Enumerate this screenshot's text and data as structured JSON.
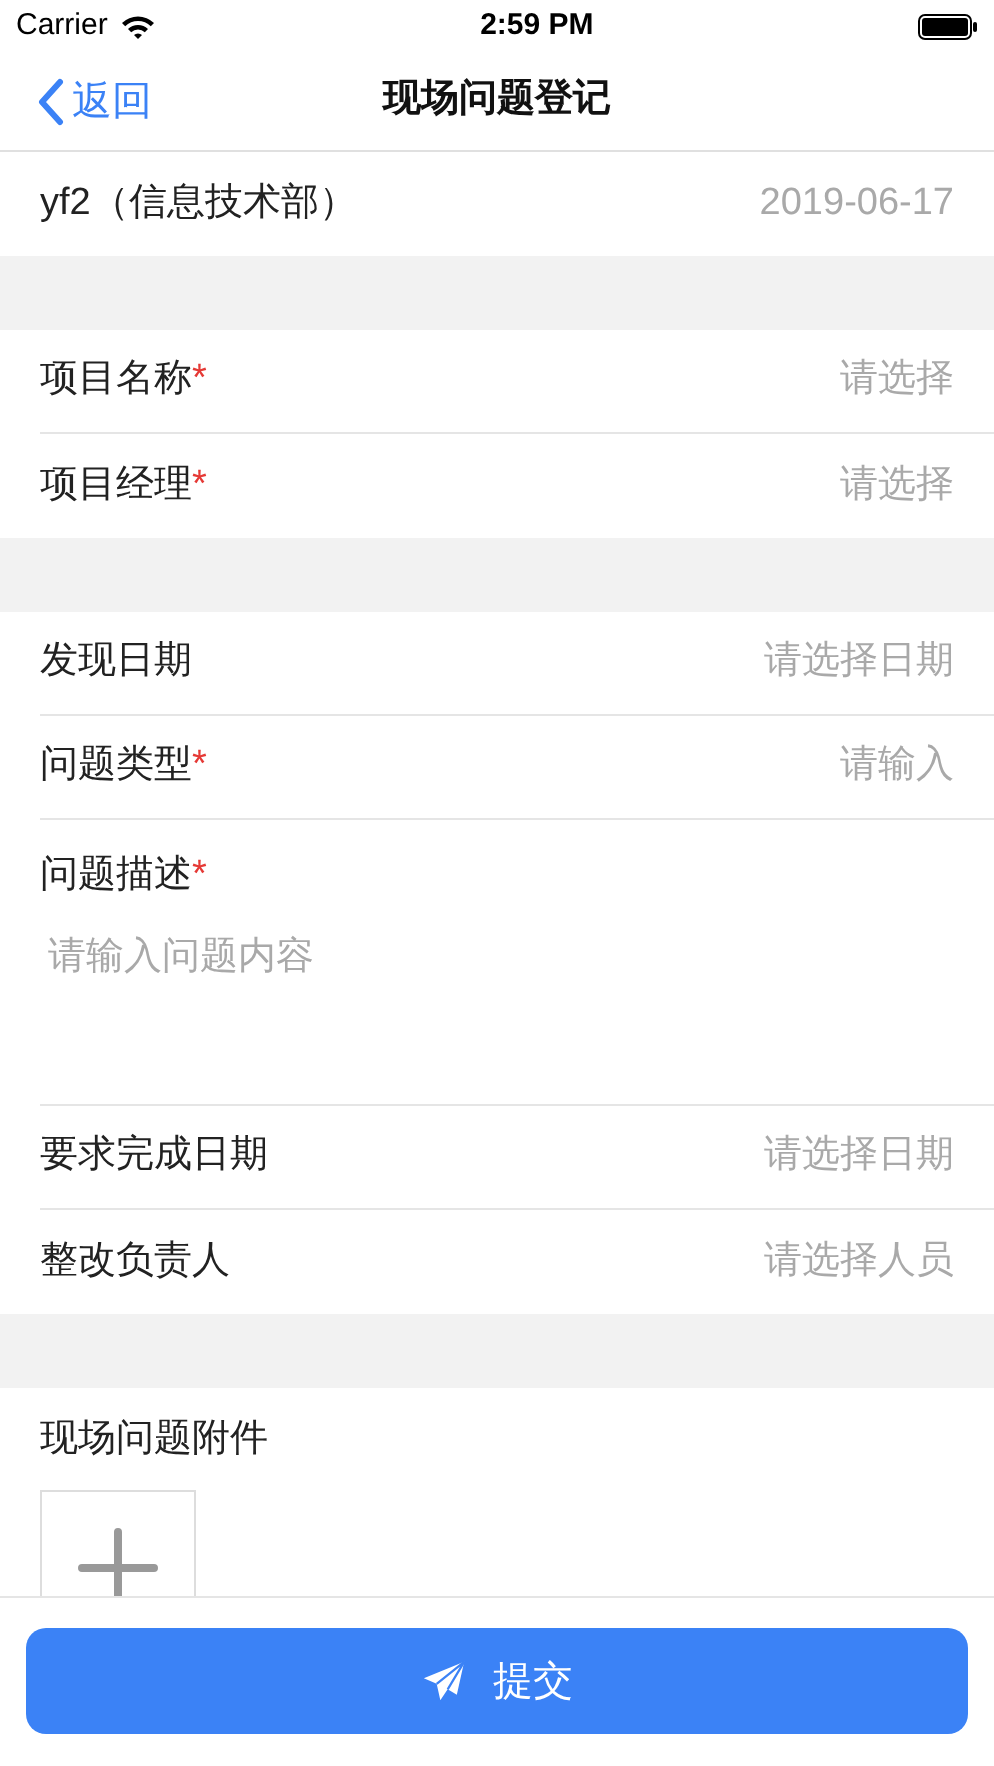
{
  "status_bar": {
    "carrier": "Carrier",
    "time": "2:59 PM"
  },
  "nav": {
    "back": "返回",
    "title": "现场问题登记"
  },
  "user": {
    "name": "yf2（信息技术部）",
    "date": "2019-06-17"
  },
  "sections": [
    {
      "fields": [
        {
          "kind": "select",
          "label": "项目名称",
          "required_mark": "*",
          "placeholder": "请选择"
        },
        {
          "kind": "select",
          "label": "项目经理",
          "required_mark": "*",
          "placeholder": "请选择"
        }
      ]
    },
    {
      "fields": [
        {
          "kind": "select",
          "label": "发现日期",
          "placeholder": "请选择日期"
        },
        {
          "kind": "select",
          "label": "问题类型",
          "required_mark": "*",
          "placeholder": "请输入"
        },
        {
          "kind": "textarea",
          "label": "问题描述",
          "required_mark": "*",
          "placeholder": "请输入问题内容"
        },
        {
          "kind": "select",
          "label": "要求完成日期",
          "placeholder": "请选择日期"
        },
        {
          "kind": "select",
          "label": "整改负责人",
          "placeholder": "请选择人员"
        }
      ]
    }
  ],
  "attachments": {
    "label": "现场问题附件"
  },
  "submit": {
    "label": "提交"
  }
}
